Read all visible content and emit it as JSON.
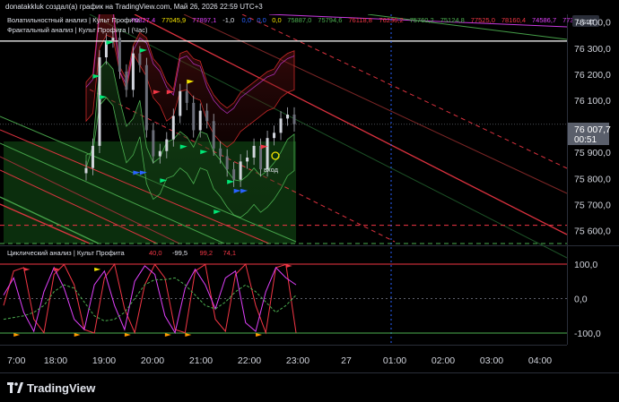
{
  "header": {
    "attribution": "donatakkluk создал(а) график на TradingView.com, Май 26, 2026 22:59 UTC+3"
  },
  "currency_badge": "USDT",
  "price_pane": {
    "indicator_1": {
      "name": "Волатильностный анализ | Культ Профита",
      "values": [
        {
          "text": "76327,4",
          "color": "#e040fb"
        },
        {
          "text": "77045,9",
          "color": "#f5e400"
        },
        {
          "text": "77897,1",
          "color": "#e040fb"
        },
        {
          "text": "-1,0",
          "color": "#e0e3eb"
        },
        {
          "text": "0,0",
          "color": "#2962ff"
        },
        {
          "text": "0,0",
          "color": "#2962ff"
        },
        {
          "text": "0,0",
          "color": "#f5e400"
        },
        {
          "text": "75887,0",
          "color": "#4caf50"
        },
        {
          "text": "75794,6",
          "color": "#4caf50"
        },
        {
          "text": "76118,8",
          "color": "#f23645"
        },
        {
          "text": "76236,2",
          "color": "#f23645"
        },
        {
          "text": "75760,2",
          "color": "#4caf50"
        },
        {
          "text": "75124,8",
          "color": "#4caf50"
        },
        {
          "text": "77525,0",
          "color": "#f23645"
        },
        {
          "text": "78160,4",
          "color": "#f23645"
        },
        {
          "text": "74586,7",
          "color": "#e040fb"
        },
        {
          "text": "77389,3",
          "color": "#e040fb"
        }
      ]
    },
    "indicator_2": {
      "name": "Фрактальный анализ | Культ Профита | (Час)"
    },
    "axis_ticks": [
      "76 400,0",
      "76 300,0",
      "76 200,0",
      "76 100,0",
      "75 900,0",
      "75 800,0",
      "75 700,0",
      "75 600,0"
    ],
    "last_price": "76 007,7",
    "countdown": "00:51",
    "entry_label": "вход"
  },
  "oscillator_pane": {
    "name": "Циклический анализ | Культ Профита",
    "values": [
      "40,0",
      "-99,5",
      "99,2",
      "74,1"
    ],
    "axis_ticks": [
      "100,0",
      "0,0",
      "-100,0"
    ]
  },
  "time_axis": [
    "7:00",
    "18:00",
    "19:00",
    "20:00",
    "21:00",
    "22:00",
    "23:00",
    "27",
    "01:00",
    "02:00",
    "03:00",
    "04:00"
  ],
  "footer": {
    "brand": "TradingView"
  },
  "chart_data": {
    "type": "line",
    "title": "",
    "price_axis": {
      "min": 75550,
      "max": 76430
    },
    "last_price": 76007.7,
    "close_series": [
      75840,
      75925,
      76265,
      76330,
      76340,
      76210,
      76140,
      76280,
      76235,
      75985,
      75885,
      75905,
      75950,
      76040,
      76135,
      76090,
      75985,
      76060,
      76020,
      75915,
      75885,
      75835,
      75795,
      75865,
      75880,
      75925,
      75835,
      75955,
      75975,
      76030,
      76045,
      76007.7
    ],
    "volatility_band_upper": [
      76110,
      76140,
      76390,
      76440,
      76400,
      76170,
      76120,
      76250,
      76300,
      76280,
      76200,
      76170,
      76110,
      76080,
      76220,
      76230,
      76200,
      76190,
      76110,
      76060,
      76030,
      76010,
      76030,
      76070,
      76090,
      76110,
      76130,
      76150,
      76160,
      76200,
      76220,
      76230
    ],
    "volatility_band_lower": [
      75930,
      75940,
      76120,
      76150,
      76120,
      76000,
      75900,
      75930,
      76000,
      75820,
      75760,
      75780,
      75840,
      75850,
      75880,
      75860,
      75820,
      75880,
      75870,
      75800,
      75770,
      75730,
      75700,
      75690,
      75710,
      75740,
      75710,
      75730,
      75760,
      75800,
      75850,
      75870
    ],
    "horizontal_levels": [
      {
        "value": 76327.4,
        "style": "solid",
        "color": "#ffffff"
      },
      {
        "value": 75620,
        "style": "dashed",
        "color": "#f23645"
      },
      {
        "value": 75550,
        "style": "dashed",
        "color": "#4caf50"
      }
    ],
    "oscillator": {
      "range": [
        -100,
        100
      ],
      "levels": [
        100,
        0,
        -100
      ],
      "magenta": [
        10,
        60,
        -40,
        -95,
        20,
        90,
        30,
        -60,
        -90,
        40,
        80,
        -20,
        -90,
        50,
        95,
        70,
        -50,
        -99,
        30,
        85,
        40,
        -30,
        60,
        80,
        -70,
        -95,
        20,
        90,
        60,
        40
      ],
      "red": [
        -20,
        80,
        90,
        -60,
        -99,
        70,
        99,
        40,
        -90,
        -100,
        60,
        100,
        -30,
        -99,
        40,
        99,
        60,
        -90,
        -99,
        80,
        99,
        -60,
        -95,
        70,
        100,
        -20,
        -99,
        90,
        99,
        -99
      ],
      "green_dashed": [
        -60,
        -55,
        -50,
        -40,
        -20,
        20,
        40,
        30,
        -10,
        -50,
        -65,
        -60,
        -40,
        0,
        40,
        55,
        55,
        60,
        40,
        10,
        -20,
        -30,
        -10,
        20,
        40,
        20,
        -10,
        -40,
        -20,
        10
      ]
    }
  }
}
